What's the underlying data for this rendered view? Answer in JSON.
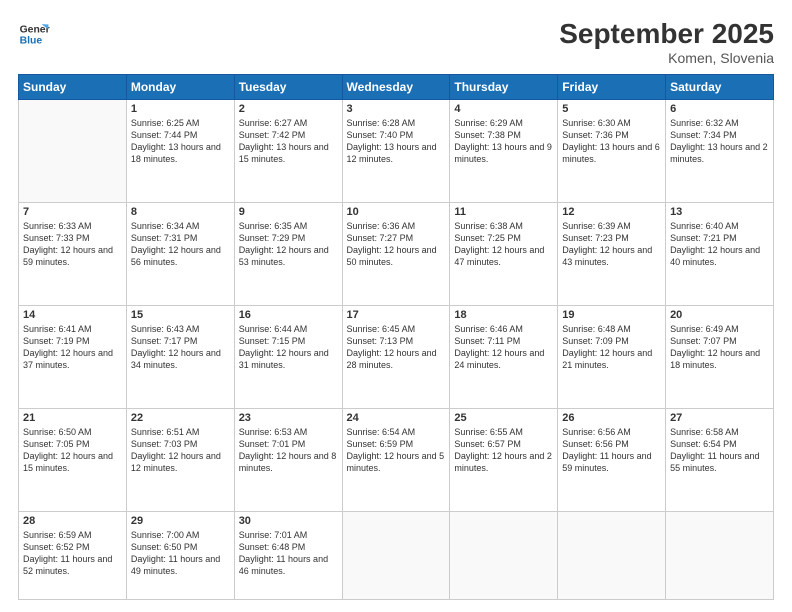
{
  "logo": {
    "line1": "General",
    "line2": "Blue"
  },
  "title": "September 2025",
  "location": "Komen, Slovenia",
  "weekdays": [
    "Sunday",
    "Monday",
    "Tuesday",
    "Wednesday",
    "Thursday",
    "Friday",
    "Saturday"
  ],
  "weeks": [
    [
      {
        "day": "",
        "sunrise": "",
        "sunset": "",
        "daylight": ""
      },
      {
        "day": "1",
        "sunrise": "Sunrise: 6:25 AM",
        "sunset": "Sunset: 7:44 PM",
        "daylight": "Daylight: 13 hours and 18 minutes."
      },
      {
        "day": "2",
        "sunrise": "Sunrise: 6:27 AM",
        "sunset": "Sunset: 7:42 PM",
        "daylight": "Daylight: 13 hours and 15 minutes."
      },
      {
        "day": "3",
        "sunrise": "Sunrise: 6:28 AM",
        "sunset": "Sunset: 7:40 PM",
        "daylight": "Daylight: 13 hours and 12 minutes."
      },
      {
        "day": "4",
        "sunrise": "Sunrise: 6:29 AM",
        "sunset": "Sunset: 7:38 PM",
        "daylight": "Daylight: 13 hours and 9 minutes."
      },
      {
        "day": "5",
        "sunrise": "Sunrise: 6:30 AM",
        "sunset": "Sunset: 7:36 PM",
        "daylight": "Daylight: 13 hours and 6 minutes."
      },
      {
        "day": "6",
        "sunrise": "Sunrise: 6:32 AM",
        "sunset": "Sunset: 7:34 PM",
        "daylight": "Daylight: 13 hours and 2 minutes."
      }
    ],
    [
      {
        "day": "7",
        "sunrise": "Sunrise: 6:33 AM",
        "sunset": "Sunset: 7:33 PM",
        "daylight": "Daylight: 12 hours and 59 minutes."
      },
      {
        "day": "8",
        "sunrise": "Sunrise: 6:34 AM",
        "sunset": "Sunset: 7:31 PM",
        "daylight": "Daylight: 12 hours and 56 minutes."
      },
      {
        "day": "9",
        "sunrise": "Sunrise: 6:35 AM",
        "sunset": "Sunset: 7:29 PM",
        "daylight": "Daylight: 12 hours and 53 minutes."
      },
      {
        "day": "10",
        "sunrise": "Sunrise: 6:36 AM",
        "sunset": "Sunset: 7:27 PM",
        "daylight": "Daylight: 12 hours and 50 minutes."
      },
      {
        "day": "11",
        "sunrise": "Sunrise: 6:38 AM",
        "sunset": "Sunset: 7:25 PM",
        "daylight": "Daylight: 12 hours and 47 minutes."
      },
      {
        "day": "12",
        "sunrise": "Sunrise: 6:39 AM",
        "sunset": "Sunset: 7:23 PM",
        "daylight": "Daylight: 12 hours and 43 minutes."
      },
      {
        "day": "13",
        "sunrise": "Sunrise: 6:40 AM",
        "sunset": "Sunset: 7:21 PM",
        "daylight": "Daylight: 12 hours and 40 minutes."
      }
    ],
    [
      {
        "day": "14",
        "sunrise": "Sunrise: 6:41 AM",
        "sunset": "Sunset: 7:19 PM",
        "daylight": "Daylight: 12 hours and 37 minutes."
      },
      {
        "day": "15",
        "sunrise": "Sunrise: 6:43 AM",
        "sunset": "Sunset: 7:17 PM",
        "daylight": "Daylight: 12 hours and 34 minutes."
      },
      {
        "day": "16",
        "sunrise": "Sunrise: 6:44 AM",
        "sunset": "Sunset: 7:15 PM",
        "daylight": "Daylight: 12 hours and 31 minutes."
      },
      {
        "day": "17",
        "sunrise": "Sunrise: 6:45 AM",
        "sunset": "Sunset: 7:13 PM",
        "daylight": "Daylight: 12 hours and 28 minutes."
      },
      {
        "day": "18",
        "sunrise": "Sunrise: 6:46 AM",
        "sunset": "Sunset: 7:11 PM",
        "daylight": "Daylight: 12 hours and 24 minutes."
      },
      {
        "day": "19",
        "sunrise": "Sunrise: 6:48 AM",
        "sunset": "Sunset: 7:09 PM",
        "daylight": "Daylight: 12 hours and 21 minutes."
      },
      {
        "day": "20",
        "sunrise": "Sunrise: 6:49 AM",
        "sunset": "Sunset: 7:07 PM",
        "daylight": "Daylight: 12 hours and 18 minutes."
      }
    ],
    [
      {
        "day": "21",
        "sunrise": "Sunrise: 6:50 AM",
        "sunset": "Sunset: 7:05 PM",
        "daylight": "Daylight: 12 hours and 15 minutes."
      },
      {
        "day": "22",
        "sunrise": "Sunrise: 6:51 AM",
        "sunset": "Sunset: 7:03 PM",
        "daylight": "Daylight: 12 hours and 12 minutes."
      },
      {
        "day": "23",
        "sunrise": "Sunrise: 6:53 AM",
        "sunset": "Sunset: 7:01 PM",
        "daylight": "Daylight: 12 hours and 8 minutes."
      },
      {
        "day": "24",
        "sunrise": "Sunrise: 6:54 AM",
        "sunset": "Sunset: 6:59 PM",
        "daylight": "Daylight: 12 hours and 5 minutes."
      },
      {
        "day": "25",
        "sunrise": "Sunrise: 6:55 AM",
        "sunset": "Sunset: 6:57 PM",
        "daylight": "Daylight: 12 hours and 2 minutes."
      },
      {
        "day": "26",
        "sunrise": "Sunrise: 6:56 AM",
        "sunset": "Sunset: 6:56 PM",
        "daylight": "Daylight: 11 hours and 59 minutes."
      },
      {
        "day": "27",
        "sunrise": "Sunrise: 6:58 AM",
        "sunset": "Sunset: 6:54 PM",
        "daylight": "Daylight: 11 hours and 55 minutes."
      }
    ],
    [
      {
        "day": "28",
        "sunrise": "Sunrise: 6:59 AM",
        "sunset": "Sunset: 6:52 PM",
        "daylight": "Daylight: 11 hours and 52 minutes."
      },
      {
        "day": "29",
        "sunrise": "Sunrise: 7:00 AM",
        "sunset": "Sunset: 6:50 PM",
        "daylight": "Daylight: 11 hours and 49 minutes."
      },
      {
        "day": "30",
        "sunrise": "Sunrise: 7:01 AM",
        "sunset": "Sunset: 6:48 PM",
        "daylight": "Daylight: 11 hours and 46 minutes."
      },
      {
        "day": "",
        "sunrise": "",
        "sunset": "",
        "daylight": ""
      },
      {
        "day": "",
        "sunrise": "",
        "sunset": "",
        "daylight": ""
      },
      {
        "day": "",
        "sunrise": "",
        "sunset": "",
        "daylight": ""
      },
      {
        "day": "",
        "sunrise": "",
        "sunset": "",
        "daylight": ""
      }
    ]
  ]
}
